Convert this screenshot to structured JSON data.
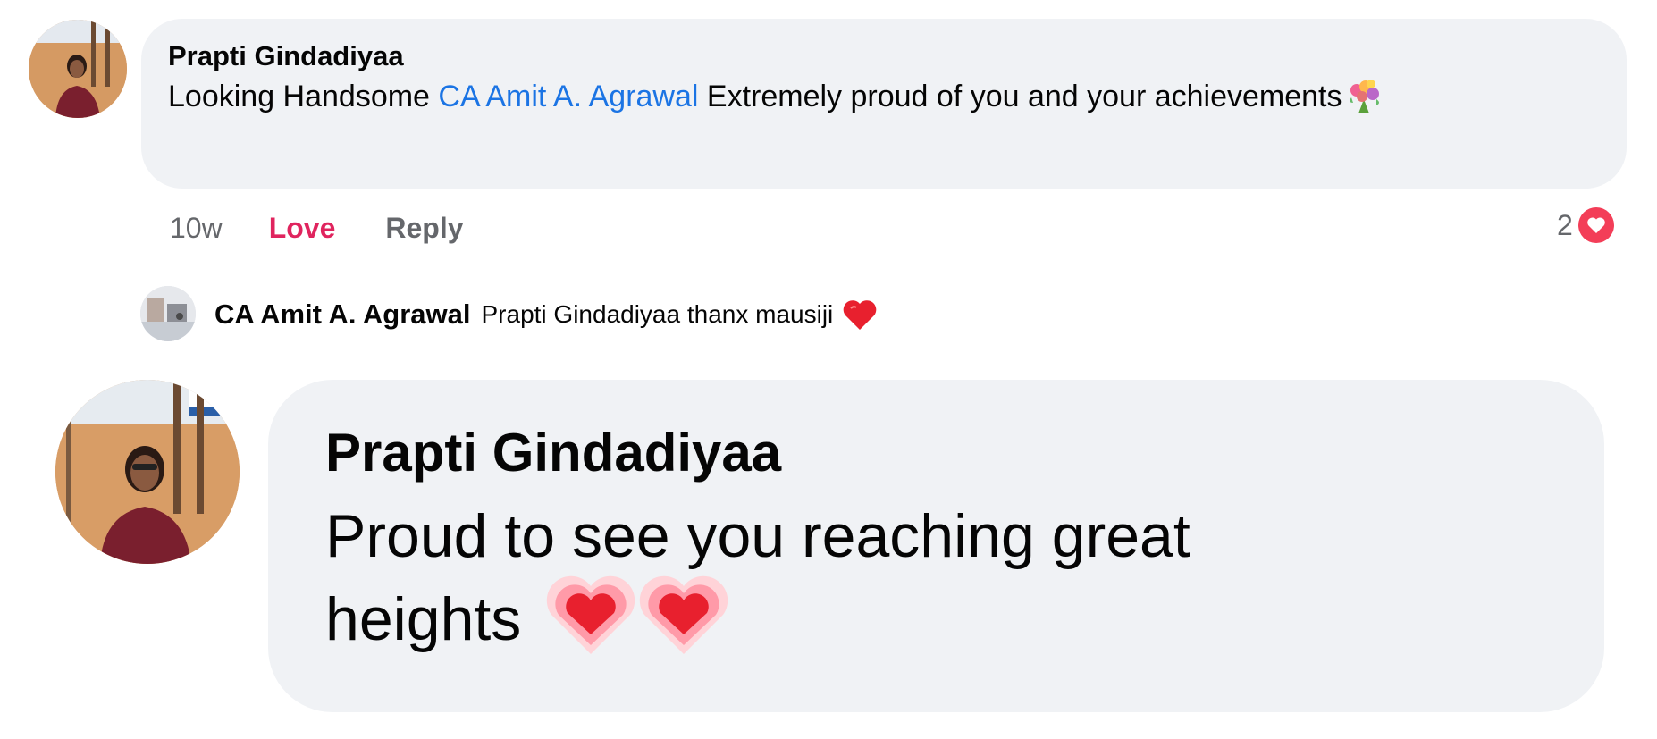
{
  "comment_1": {
    "author": "Prapti Gindadiyaa",
    "text_before": "Looking Handsome ",
    "mention": "CA Amit A. Agrawal",
    "text_after": " Extremely proud of you and your achievements",
    "emoji_icon": "bouquet-icon",
    "time": "10w",
    "love_label": "Love",
    "reply_label": "Reply",
    "reaction_count": "2",
    "reaction_icon": "love-reaction-icon"
  },
  "reply": {
    "author": "CA Amit A. Agrawal",
    "text": "Prapti Gindadiyaa thanx mausiji",
    "emoji_icon": "red-heart-icon"
  },
  "comment_2": {
    "author": "Prapti Gindadiyaa",
    "text": "Proud to see you reaching great heights",
    "emoji_icons": [
      "beating-heart-icon",
      "beating-heart-icon"
    ]
  },
  "colors": {
    "bubble_bg": "#f0f2f5",
    "mention": "#1b74e4",
    "love": "#e0245e",
    "meta": "#65676b",
    "love_badge": "#f33e58"
  }
}
